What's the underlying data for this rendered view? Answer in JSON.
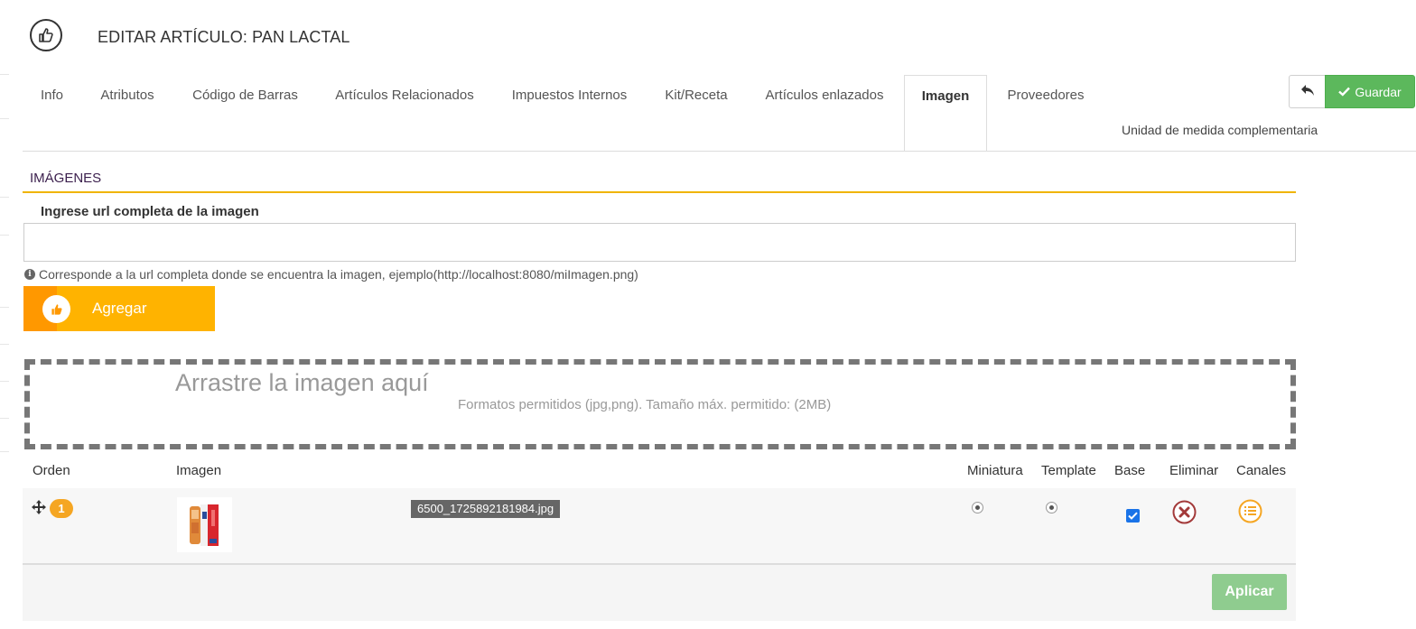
{
  "header": {
    "icon": "thumbs-up-icon",
    "title": "EDITAR ARTÍCULO: PAN LACTAL"
  },
  "tabs": [
    {
      "label": "Info",
      "active": false
    },
    {
      "label": "Atributos",
      "active": false
    },
    {
      "label": "Código de Barras",
      "active": false
    },
    {
      "label": "Artículos Relacionados",
      "active": false
    },
    {
      "label": "Impuestos Internos",
      "active": false
    },
    {
      "label": "Kit/Receta",
      "active": false
    },
    {
      "label": "Artículos enlazados",
      "active": false
    },
    {
      "label": "Imagen",
      "active": true
    },
    {
      "label": "Proveedores",
      "active": false
    },
    {
      "label": "Unidad de medida complementaria",
      "active": false
    }
  ],
  "toolbar": {
    "back_icon": "reply-arrow-icon",
    "save_label": "Guardar",
    "save_icon": "check-icon"
  },
  "section": {
    "title": "IMÁGENES",
    "url_label": "Ingrese url completa de la imagen",
    "url_value": "",
    "url_placeholder": "",
    "help_text": "Corresponde a la url completa donde se encuentra la imagen, ejemplo(http://localhost:8080/miImagen.png)",
    "add_label": "Agregar"
  },
  "dropzone": {
    "title": "Arrastre la imagen aquí",
    "subtitle": "Formatos permitidos (jpg,png). Tamaño máx. permitido: (2MB)"
  },
  "table": {
    "headers": [
      "Orden",
      "Imagen",
      "Miniatura",
      "Template",
      "Base",
      "Eliminar",
      "Canales"
    ],
    "rows": [
      {
        "order": "1",
        "filename": "6500_1725892181984.jpg",
        "miniatura_selected": true,
        "template_selected": true,
        "base_checked": true
      }
    ],
    "apply_label": "Aplicar"
  },
  "colors": {
    "accent_orange": "#ffb300",
    "save_green": "#5cb85c",
    "apply_green": "#8fcc8f",
    "delete_red": "#b03030",
    "section_rule": "#f0b400"
  }
}
